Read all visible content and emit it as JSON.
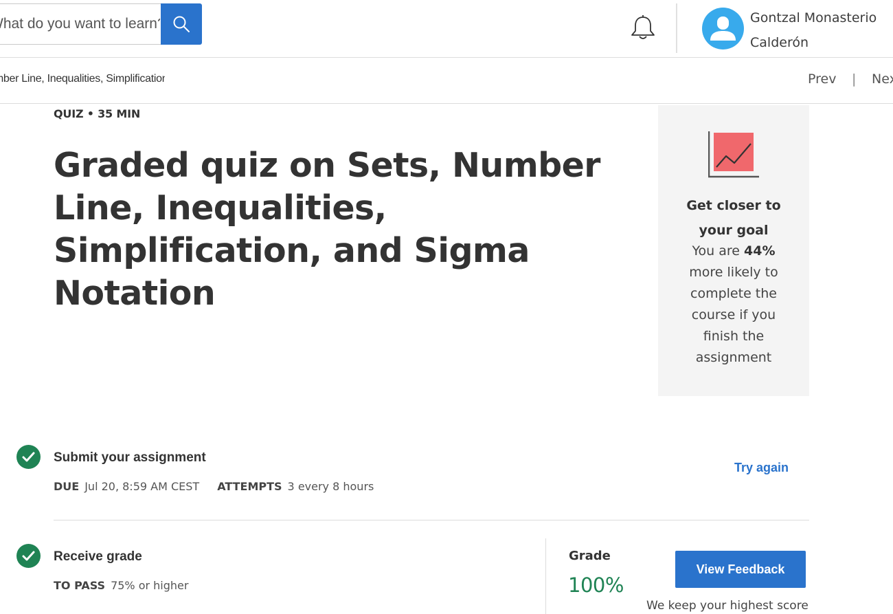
{
  "header": {
    "search": {
      "placeholder": "What do you want to learn?"
    },
    "icons": {
      "search": "search-icon",
      "notifications": "bell-icon",
      "avatar": "user-avatar-icon"
    },
    "user": {
      "name": "Gontzal Monasterio Calderón"
    }
  },
  "breadcrumb": {
    "text": "Number Line, Inequalities, Simplification, and Sigma Notation",
    "prev": "Prev",
    "separator": "|",
    "next": "Next"
  },
  "quiz": {
    "meta": "QUIZ • 35 MIN",
    "title": "Graded quiz on Sets, Number Line, Inequalities, Simplification, and Sigma Notation"
  },
  "goal_card": {
    "icon": "trend-chart-icon",
    "title": "Get closer to your goal",
    "text_before": "You are ",
    "percent": "44%",
    "text_after": " more likely to complete the course if you finish the assignment"
  },
  "steps": {
    "submit": {
      "title": "Submit your assignment",
      "due_label": "DUE",
      "due_value": "Jul 20, 8:59 AM CEST",
      "attempts_label": "ATTEMPTS",
      "attempts_value": "3 every 8 hours",
      "action": "Try again"
    },
    "receive": {
      "title": "Receive grade",
      "pass_label": "TO PASS",
      "pass_value": "75% or higher",
      "grade_label": "Grade",
      "grade_value": "100%",
      "button": "View Feedback",
      "note": "We keep your highest score"
    }
  },
  "colors": {
    "primary_blue": "#2a73cc",
    "success_green": "#1f8354",
    "avatar_blue": "#38aaec",
    "chart_red": "#f0686c",
    "card_gray": "#f4f4f4"
  }
}
